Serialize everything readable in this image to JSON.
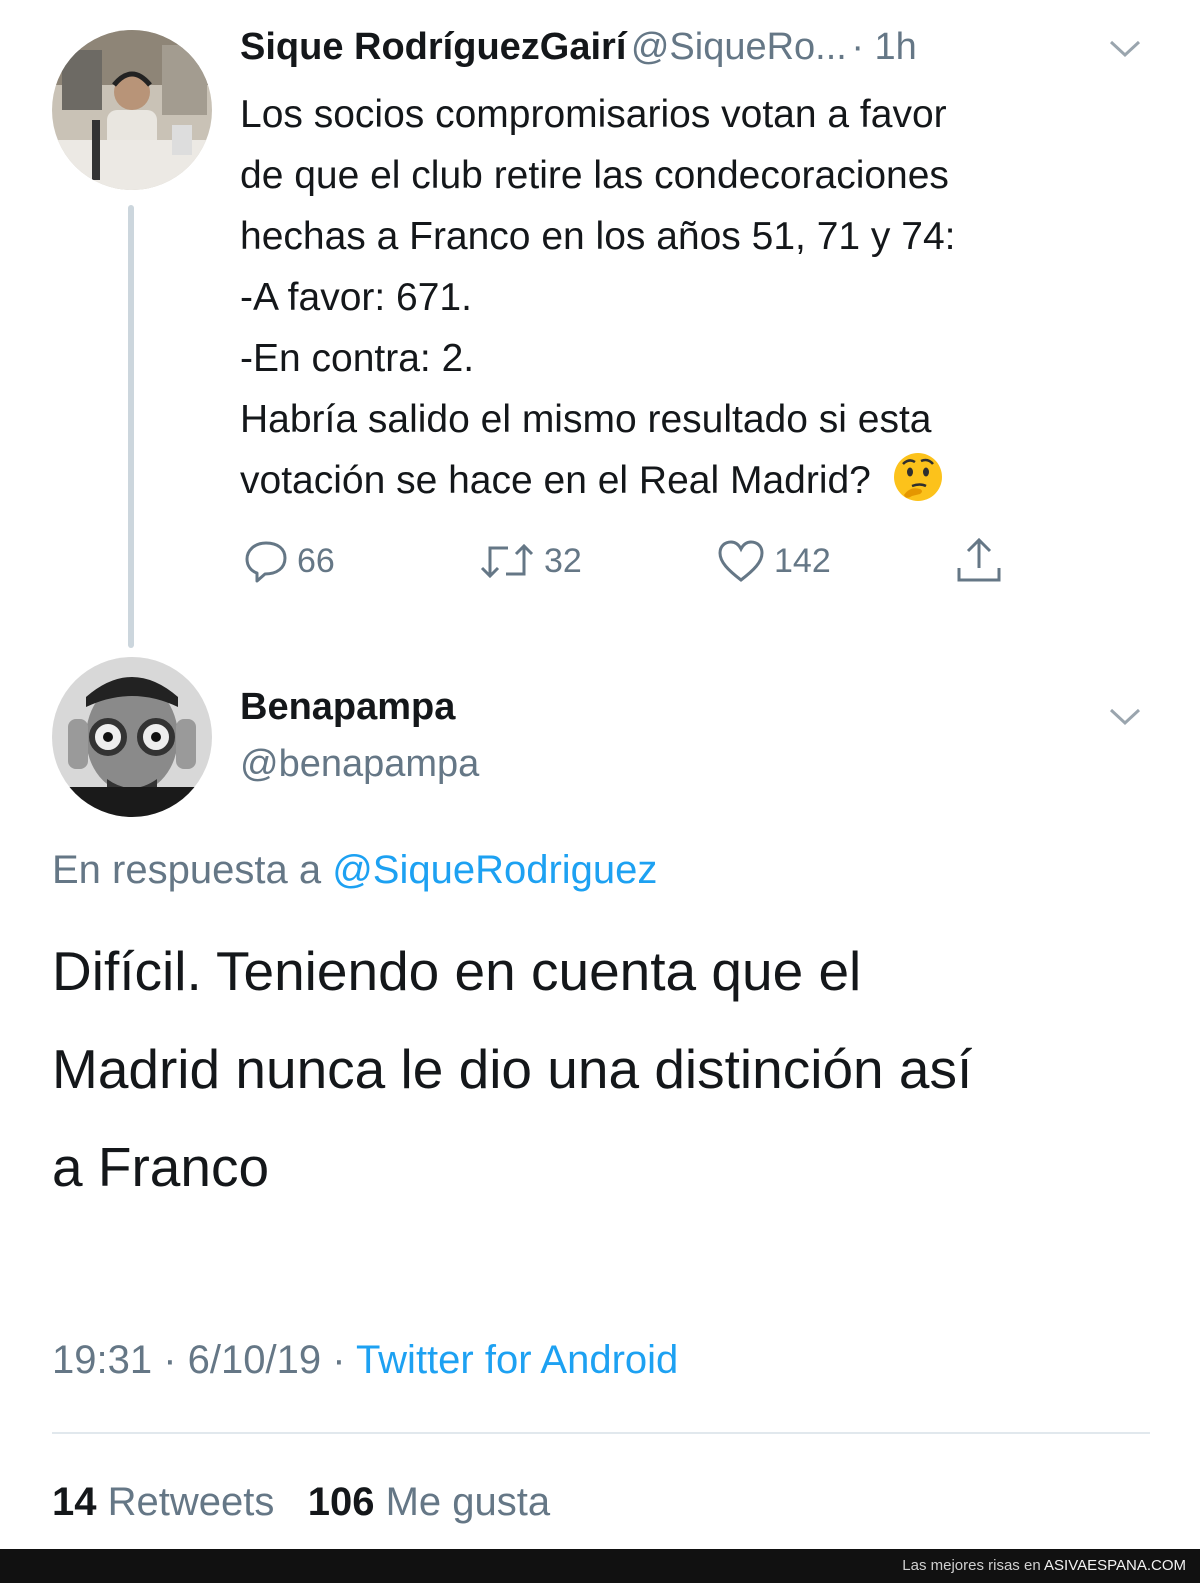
{
  "tweet1": {
    "name": "Sique RodríguezGairí",
    "handle": "@SiqueRo...",
    "time": "· 1h",
    "lines": [
      "Los socios compromisarios votan a favor",
      "de que el club retire las condecoraciones",
      "hechas a Franco en los años 51, 71 y 74:",
      "-A favor: 671.",
      "-En contra: 2.",
      "Habría salido el mismo resultado si esta",
      "votación se hace en el Real Madrid?"
    ],
    "emoji": "thinking-face-emoji",
    "replies": "66",
    "retweets": "32",
    "likes": "142"
  },
  "tweet2": {
    "name": "Benapampa",
    "handle": "@benapampa",
    "reply_prefix": "En respuesta a",
    "reply_to": "@SiqueRodriguez",
    "lines": [
      "Difícil. Teniendo en cuenta que el",
      "Madrid nunca le dio una distinción así",
      "a Franco"
    ],
    "timestamp": "19:31 · 6/10/19 ·",
    "source": "Twitter for Android",
    "retweet_count": "14",
    "retweet_label": "Retweets",
    "like_count": "106",
    "like_label": "Me gusta"
  },
  "footer": {
    "prefix": "Las mejores risas en",
    "site": "ASIVAESPANA.COM"
  },
  "colors": {
    "link": "#1da1f2",
    "secondary": "#657786",
    "text": "#14171a",
    "thread_line": "#ccd6dd"
  }
}
